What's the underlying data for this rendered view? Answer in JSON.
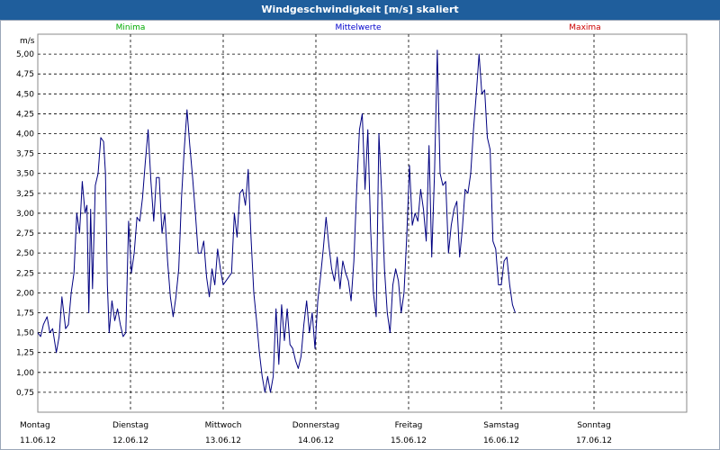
{
  "window": {
    "title": "Windgeschwindigkeit [m/s] skaliert"
  },
  "legend": {
    "minima": "Minima",
    "mittelwerte": "Mittelwerte",
    "maxima": "Maxima"
  },
  "colors": {
    "minima": "#00aa00",
    "mittelwerte": "#0000cc",
    "maxima": "#cc0000",
    "series": "#000080",
    "titlebar": "#1f5e9c"
  },
  "chart_data": {
    "type": "line",
    "title": "Windgeschwindigkeit [m/s] skaliert",
    "ylabel": "m/s",
    "ylim": [
      0.5,
      5.25
    ],
    "yticks": [
      "0,75",
      "1,00",
      "1,25",
      "1,50",
      "1,75",
      "2,00",
      "2,25",
      "2,50",
      "2,75",
      "3,00",
      "3,25",
      "3,50",
      "3,75",
      "4,00",
      "4,25",
      "4,50",
      "4,75",
      "5,00"
    ],
    "xlim": [
      0,
      7
    ],
    "days": [
      {
        "name": "Montag",
        "date": "11.06.12"
      },
      {
        "name": "Dienstag",
        "date": "12.06.12"
      },
      {
        "name": "Mittwoch",
        "date": "13.06.12"
      },
      {
        "name": "Donnerstag",
        "date": "14.06.12"
      },
      {
        "name": "Freitag",
        "date": "15.06.12"
      },
      {
        "name": "Samstag",
        "date": "16.06.12"
      },
      {
        "name": "Sonntag",
        "date": "17.06.12"
      }
    ],
    "grid": true,
    "series": [
      {
        "name": "Mittelwerte",
        "points": [
          [
            0.0,
            1.5
          ],
          [
            0.03,
            1.45
          ],
          [
            0.06,
            1.6
          ],
          [
            0.1,
            1.7
          ],
          [
            0.13,
            1.5
          ],
          [
            0.16,
            1.55
          ],
          [
            0.2,
            1.25
          ],
          [
            0.23,
            1.45
          ],
          [
            0.26,
            1.95
          ],
          [
            0.3,
            1.55
          ],
          [
            0.33,
            1.6
          ],
          [
            0.36,
            2.0
          ],
          [
            0.39,
            2.25
          ],
          [
            0.42,
            3.0
          ],
          [
            0.45,
            2.75
          ],
          [
            0.48,
            3.4
          ],
          [
            0.51,
            3.0
          ],
          [
            0.53,
            3.1
          ],
          [
            0.55,
            1.75
          ],
          [
            0.57,
            3.05
          ],
          [
            0.59,
            2.05
          ],
          [
            0.62,
            3.35
          ],
          [
            0.65,
            3.5
          ],
          [
            0.68,
            3.95
          ],
          [
            0.71,
            3.9
          ],
          [
            0.73,
            3.5
          ],
          [
            0.75,
            2.1
          ],
          [
            0.77,
            1.5
          ],
          [
            0.8,
            1.9
          ],
          [
            0.83,
            1.65
          ],
          [
            0.86,
            1.8
          ],
          [
            0.89,
            1.6
          ],
          [
            0.92,
            1.45
          ],
          [
            0.95,
            1.5
          ],
          [
            0.98,
            2.9
          ],
          [
            1.01,
            2.25
          ],
          [
            1.04,
            2.5
          ],
          [
            1.07,
            2.95
          ],
          [
            1.1,
            2.9
          ],
          [
            1.13,
            3.2
          ],
          [
            1.16,
            3.65
          ],
          [
            1.19,
            4.05
          ],
          [
            1.22,
            3.4
          ],
          [
            1.25,
            2.9
          ],
          [
            1.28,
            3.45
          ],
          [
            1.31,
            3.45
          ],
          [
            1.34,
            2.75
          ],
          [
            1.37,
            3.0
          ],
          [
            1.4,
            2.4
          ],
          [
            1.43,
            1.95
          ],
          [
            1.46,
            1.7
          ],
          [
            1.49,
            1.95
          ],
          [
            1.52,
            2.3
          ],
          [
            1.55,
            3.2
          ],
          [
            1.58,
            3.8
          ],
          [
            1.61,
            4.3
          ],
          [
            1.64,
            3.85
          ],
          [
            1.67,
            3.45
          ],
          [
            1.7,
            3.0
          ],
          [
            1.73,
            2.5
          ],
          [
            1.76,
            2.5
          ],
          [
            1.79,
            2.65
          ],
          [
            1.82,
            2.2
          ],
          [
            1.85,
            1.95
          ],
          [
            1.88,
            2.3
          ],
          [
            1.91,
            2.1
          ],
          [
            1.94,
            2.55
          ],
          [
            1.97,
            2.3
          ],
          [
            2.0,
            2.1
          ],
          [
            2.03,
            2.15
          ],
          [
            2.06,
            2.2
          ],
          [
            2.09,
            2.25
          ],
          [
            2.12,
            3.0
          ],
          [
            2.15,
            2.7
          ],
          [
            2.18,
            3.25
          ],
          [
            2.21,
            3.3
          ],
          [
            2.24,
            3.1
          ],
          [
            2.27,
            3.55
          ],
          [
            2.3,
            2.7
          ],
          [
            2.33,
            2.0
          ],
          [
            2.36,
            1.65
          ],
          [
            2.39,
            1.25
          ],
          [
            2.42,
            0.95
          ],
          [
            2.45,
            0.75
          ],
          [
            2.48,
            0.95
          ],
          [
            2.51,
            0.75
          ],
          [
            2.54,
            0.95
          ],
          [
            2.57,
            1.8
          ],
          [
            2.6,
            1.1
          ],
          [
            2.63,
            1.85
          ],
          [
            2.66,
            1.4
          ],
          [
            2.69,
            1.8
          ],
          [
            2.72,
            1.35
          ],
          [
            2.75,
            1.3
          ],
          [
            2.78,
            1.15
          ],
          [
            2.81,
            1.05
          ],
          [
            2.84,
            1.2
          ],
          [
            2.87,
            1.6
          ],
          [
            2.9,
            1.9
          ],
          [
            2.93,
            1.5
          ],
          [
            2.96,
            1.75
          ],
          [
            2.99,
            1.3
          ],
          [
            3.02,
            1.9
          ],
          [
            3.05,
            2.2
          ],
          [
            3.08,
            2.55
          ],
          [
            3.11,
            2.95
          ],
          [
            3.14,
            2.6
          ],
          [
            3.17,
            2.3
          ],
          [
            3.2,
            2.15
          ],
          [
            3.23,
            2.45
          ],
          [
            3.26,
            2.05
          ],
          [
            3.29,
            2.4
          ],
          [
            3.32,
            2.25
          ],
          [
            3.35,
            2.15
          ],
          [
            3.38,
            1.9
          ],
          [
            3.41,
            2.4
          ],
          [
            3.44,
            3.3
          ],
          [
            3.47,
            4.05
          ],
          [
            3.5,
            4.25
          ],
          [
            3.53,
            3.3
          ],
          [
            3.56,
            4.05
          ],
          [
            3.59,
            2.8
          ],
          [
            3.62,
            2.0
          ],
          [
            3.65,
            1.7
          ],
          [
            3.68,
            4.0
          ],
          [
            3.71,
            3.25
          ],
          [
            3.74,
            2.3
          ],
          [
            3.77,
            1.75
          ],
          [
            3.8,
            1.5
          ],
          [
            3.83,
            2.1
          ],
          [
            3.86,
            2.3
          ],
          [
            3.89,
            2.15
          ],
          [
            3.92,
            1.75
          ],
          [
            3.95,
            2.0
          ],
          [
            3.98,
            2.7
          ],
          [
            4.01,
            3.6
          ],
          [
            4.04,
            2.85
          ],
          [
            4.07,
            3.0
          ],
          [
            4.1,
            2.9
          ],
          [
            4.13,
            3.3
          ],
          [
            4.16,
            3.05
          ],
          [
            4.19,
            2.65
          ],
          [
            4.22,
            3.85
          ],
          [
            4.25,
            2.45
          ],
          [
            4.28,
            3.5
          ],
          [
            4.31,
            5.05
          ],
          [
            4.34,
            3.5
          ],
          [
            4.37,
            3.35
          ],
          [
            4.4,
            3.4
          ],
          [
            4.43,
            2.5
          ],
          [
            4.46,
            2.85
          ],
          [
            4.49,
            3.05
          ],
          [
            4.52,
            3.15
          ],
          [
            4.55,
            2.45
          ],
          [
            4.58,
            2.8
          ],
          [
            4.61,
            3.3
          ],
          [
            4.64,
            3.25
          ],
          [
            4.67,
            3.5
          ],
          [
            4.7,
            4.05
          ],
          [
            4.73,
            4.5
          ],
          [
            4.76,
            5.0
          ],
          [
            4.79,
            4.5
          ],
          [
            4.82,
            4.55
          ],
          [
            4.85,
            3.95
          ],
          [
            4.88,
            3.8
          ],
          [
            4.91,
            2.65
          ],
          [
            4.94,
            2.55
          ],
          [
            4.97,
            2.1
          ],
          [
            5.0,
            2.1
          ],
          [
            5.03,
            2.4
          ],
          [
            5.06,
            2.45
          ],
          [
            5.09,
            2.1
          ],
          [
            5.12,
            1.85
          ],
          [
            5.15,
            1.75
          ]
        ]
      }
    ]
  }
}
